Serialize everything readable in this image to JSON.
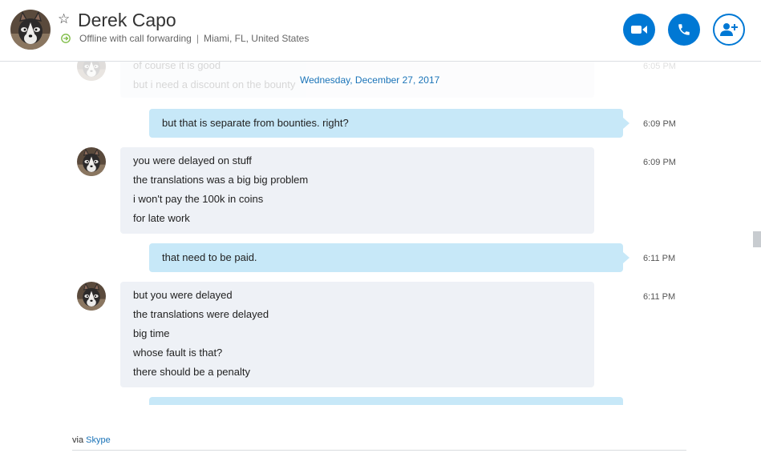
{
  "contact": {
    "name": "Derek Capo",
    "status": "Offline with call forwarding",
    "location": "Miami, FL, United States"
  },
  "header_buttons": {
    "video_icon": "video-camera-icon",
    "call_icon": "phone-icon",
    "add_user_icon": "add-user-icon"
  },
  "colors": {
    "accent": "#0078d4",
    "incoming_bubble": "#eef1f6",
    "outgoing_bubble": "#c7e8f8",
    "date_text": "#1a73b8"
  },
  "chat": {
    "date_separator": "Wednesday, December 27, 2017",
    "faded_message": {
      "lines": [
        "of course it is good",
        "but i need a discount on the bounty"
      ],
      "time": "6:05 PM"
    },
    "messages": [
      {
        "direction": "outgoing",
        "lines": [
          "but that is separate from bounties. right?"
        ],
        "time": "6:09 PM"
      },
      {
        "direction": "incoming",
        "lines": [
          "you were delayed on stuff",
          "the translations was a big big problem",
          "i won't pay the 100k in coins",
          "for late work"
        ],
        "time": "6:09 PM"
      },
      {
        "direction": "outgoing",
        "lines": [
          "that need to be paid."
        ],
        "time": "6:11 PM"
      },
      {
        "direction": "incoming",
        "lines": [
          "but you were delayed",
          "the translations were delayed",
          "big time",
          "whose fault is that?",
          "there should be a penalty"
        ],
        "time": "6:11 PM"
      }
    ]
  },
  "footer": {
    "via_label": "via",
    "via_link": "Skype"
  }
}
